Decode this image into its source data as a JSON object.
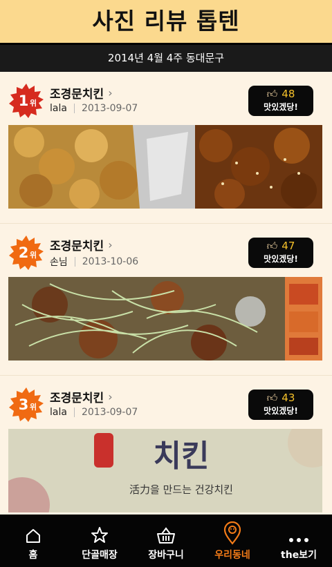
{
  "header": {
    "title": "사진 리뷰 톱텐"
  },
  "subheader": {
    "text": "2014년 4월 4주  동대문구"
  },
  "reviews": [
    {
      "rank": "1",
      "rank_suffix": "위",
      "store": "조경문치킨",
      "user": "lala",
      "date": "2013-09-07",
      "likes": "48",
      "like_label": "맛있겠당!",
      "badge_color": "#d62b1f"
    },
    {
      "rank": "2",
      "rank_suffix": "위",
      "store": "조경문치킨",
      "user": "손님",
      "date": "2013-10-06",
      "likes": "47",
      "like_label": "맛있겠당!",
      "badge_color": "#f06a12"
    },
    {
      "rank": "3",
      "rank_suffix": "위",
      "store": "조경문치킨",
      "user": "lala",
      "date": "2013-09-07",
      "likes": "43",
      "like_label": "맛있겠당!",
      "badge_color": "#f06a12"
    }
  ],
  "photo3_text": {
    "brand": "치킨",
    "tagline": "活力을 만드는 건강치킨"
  },
  "tabs": [
    {
      "label": "홈",
      "icon": "home-icon",
      "active": false
    },
    {
      "label": "단골매장",
      "icon": "star-icon",
      "active": false
    },
    {
      "label": "장바구니",
      "icon": "basket-icon",
      "active": false
    },
    {
      "label": "우리동네",
      "icon": "location-pin-icon",
      "active": true
    },
    {
      "label": "the보기",
      "icon": "more-dots-icon",
      "active": false
    }
  ],
  "colors": {
    "header_bg": "#fbd98e",
    "accent": "#f57c18",
    "like_count": "#f7c22a"
  }
}
